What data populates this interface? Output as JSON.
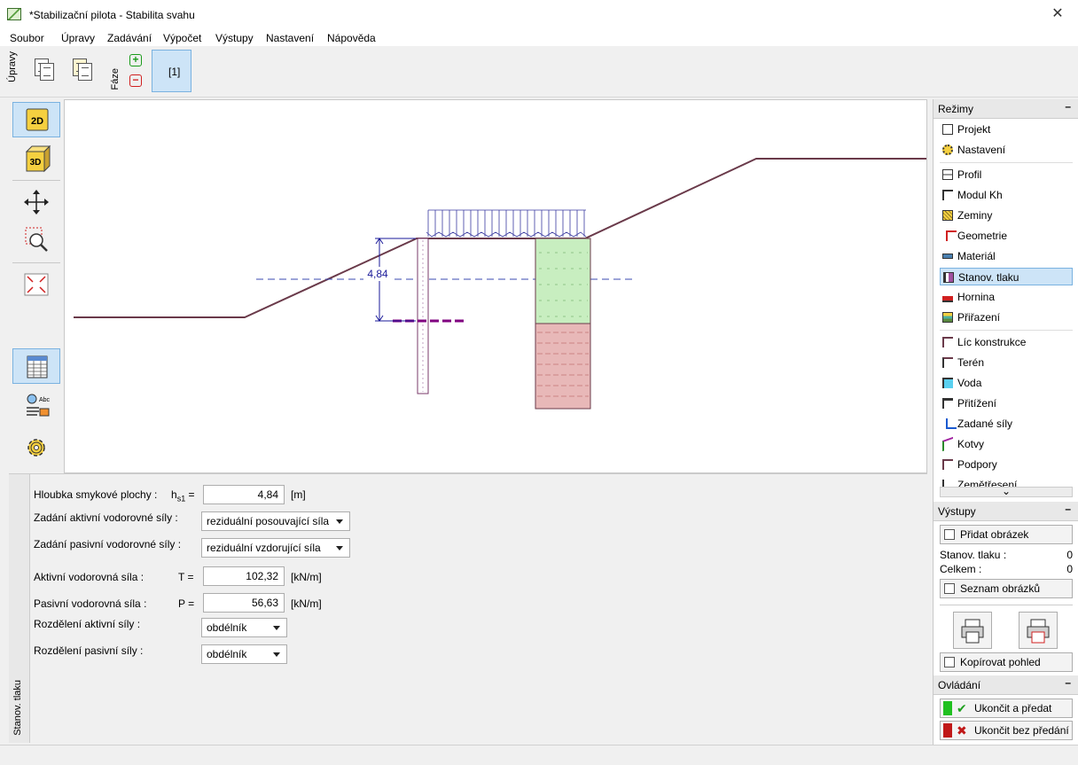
{
  "window": {
    "title": "*Stabilizační pilota - Stabilita svahu",
    "close_symbol": "✕"
  },
  "menu": [
    "Soubor",
    "Úpravy",
    "Zadávání",
    "Výpočet",
    "Výstupy",
    "Nastavení",
    "Nápověda"
  ],
  "toolbar": {
    "edit_group_label": "Úpravy",
    "phase_group_label": "Fáze",
    "phase_tab": "[1]",
    "add_phase": "+",
    "remove_phase": "−"
  },
  "left_tools": {
    "view_2d": "2D",
    "view_3d": "3D",
    "texts_icon_label": "Abc"
  },
  "canvas": {
    "depth_label": "4,84"
  },
  "form": {
    "vertical_tab": "Stanov. tlaku",
    "depth_label": "Hloubka smykové plochy :",
    "depth_symbol_main": "h",
    "depth_symbol_sub": "s1",
    "depth_symbol_eq": "=",
    "depth_value": "4,84",
    "depth_unit": "[m]",
    "active_input_label": "Zadání aktivní vodorovné síly :",
    "active_input_value": "reziduální posouvající síla",
    "passive_input_label": "Zadání pasivní vodorovné síly :",
    "passive_input_value": "reziduální vzdorující síla",
    "active_force_label": "Aktivní vodorovná síla :",
    "active_force_symbol": "T =",
    "active_force_value": "102,32",
    "active_force_unit": "[kN/m]",
    "passive_force_label": "Pasivní vodorovná síla :",
    "passive_force_symbol": "P =",
    "passive_force_value": "56,63",
    "passive_force_unit": "[kN/m]",
    "active_dist_label": "Rozdělení aktivní síly :",
    "active_dist_value": "obdélník",
    "passive_dist_label": "Rozdělení pasivní síly :",
    "passive_dist_value": "obdélník"
  },
  "modes": {
    "header": "Režimy",
    "minimize": "–",
    "items": [
      "Projekt",
      "Nastavení",
      "Profil",
      "Modul Kh",
      "Zeminy",
      "Geometrie",
      "Materiál",
      "Stanov. tlaku",
      "Hornina",
      "Přiřazení",
      "Líc konstrukce",
      "Terén",
      "Voda",
      "Přitížení",
      "Zadané síly",
      "Kotvy",
      "Podpory",
      "Zemětřesení"
    ],
    "selected": "Stanov. tlaku",
    "more_symbol": "⌄"
  },
  "outputs": {
    "header": "Výstupy",
    "minimize": "–",
    "add_picture": "Přidat obrázek",
    "stanov_label": "Stanov. tlaku :",
    "stanov_value": "0",
    "total_label": "Celkem :",
    "total_value": "0",
    "picture_list": "Seznam obrázků",
    "copy_view": "Kopírovat pohled"
  },
  "controls": {
    "header": "Ovládání",
    "minimize": "–",
    "finish_submit": "Ukončit a předat",
    "finish_no_submit": "Ukončit bez předání"
  },
  "colors": {
    "selected_bg": "#cde4f7",
    "selected_border": "#7ab2e0",
    "terrain": "#6a3a4a",
    "soil_green": "#c8eec0",
    "soil_red": "#e8b8b8",
    "dim_blue": "#1a1a9a"
  }
}
